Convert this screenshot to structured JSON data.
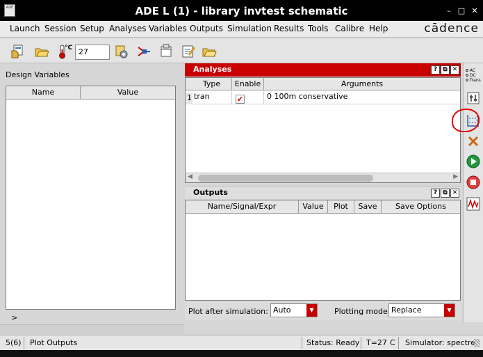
{
  "window": {
    "icon_text": "ADE",
    "title": "ADE L (1) - library invtest schematic",
    "minimize": "–",
    "maximize": "□",
    "close": "✕"
  },
  "menubar": {
    "items": [
      "Launch",
      "Session",
      "Setup",
      "Analyses",
      "Variables",
      "Outputs",
      "Simulation",
      "Results",
      "Tools",
      "Calibre",
      "Help"
    ],
    "brand": "cādence"
  },
  "toolbar": {
    "temp_unit": "°C",
    "temperature": "27"
  },
  "design_variables": {
    "label": "Design Variables",
    "columns": [
      "Name",
      "Value"
    ],
    "expand": ">"
  },
  "analyses": {
    "title": "Analyses",
    "buttons": [
      "?",
      "⧉",
      "✕"
    ],
    "columns": [
      "Type",
      "Enable",
      "Arguments"
    ],
    "rows": [
      {
        "index": "1",
        "type": "tran",
        "enabled": "✔",
        "arguments": "0 100m conservative"
      }
    ]
  },
  "outputs": {
    "title": "Outputs",
    "buttons": [
      "?",
      "⧉",
      "✕"
    ],
    "columns": [
      "Name/Signal/Expr",
      "Value",
      "Plot",
      "Save",
      "Save Options"
    ]
  },
  "plot": {
    "after_sim_label": "Plot after simulation:",
    "after_sim_value": "Auto",
    "mode_label": "Plotting mode:",
    "mode_value": "Replace"
  },
  "sidebar": {
    "analysis_types": [
      "AC",
      "DC",
      "Trans"
    ]
  },
  "status": {
    "count": "5(6)",
    "message": "Plot Outputs",
    "state": "Status: Ready",
    "temp": "T=27",
    "unit": "C",
    "simulator": "Simulator: spectre"
  },
  "colors": {
    "accent": "#c80000",
    "title_bg": "#000000",
    "annotation": "#e00000"
  }
}
